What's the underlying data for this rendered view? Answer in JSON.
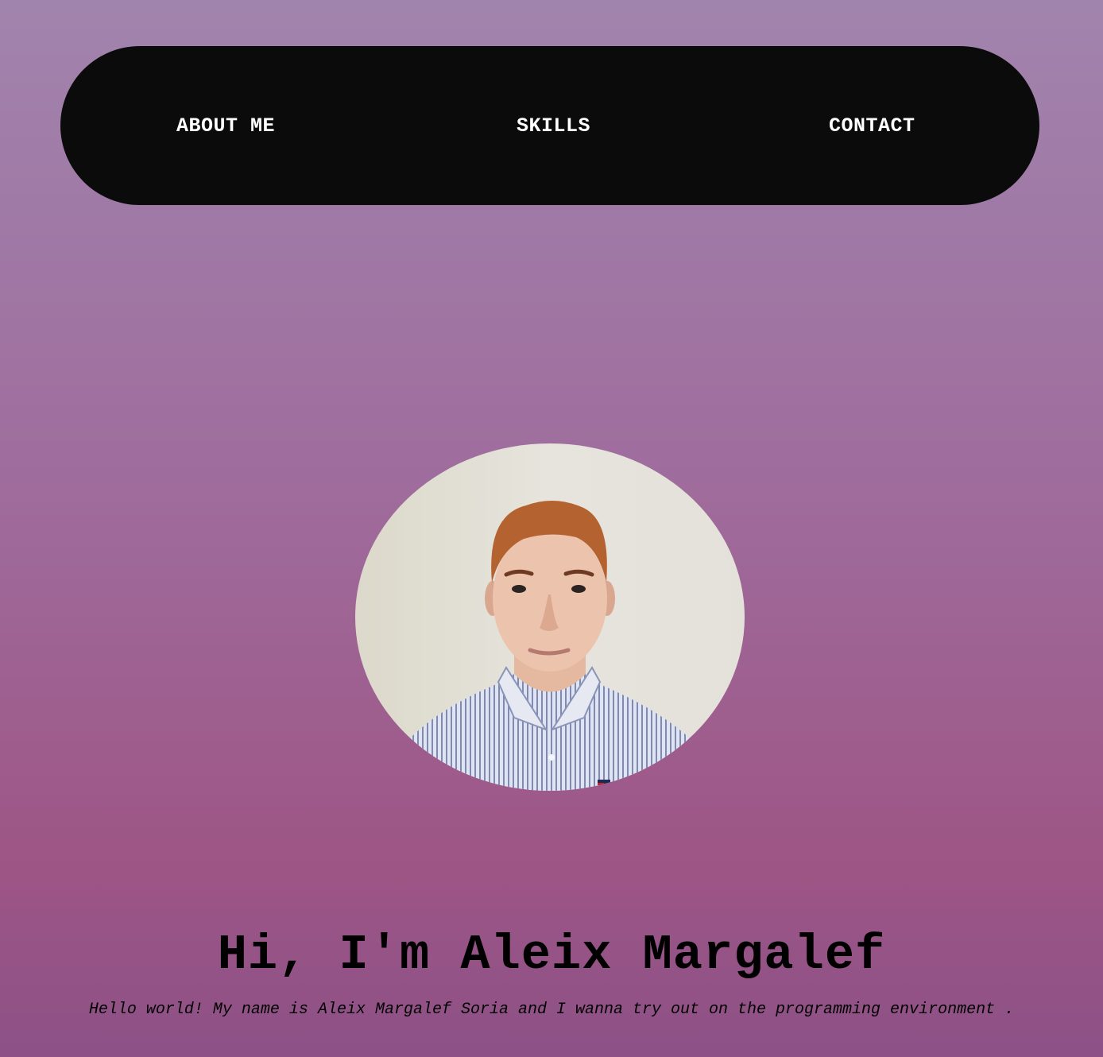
{
  "nav": {
    "items": [
      {
        "label": "ABOUT ME"
      },
      {
        "label": "SKILLS"
      },
      {
        "label": "CONTACT"
      }
    ]
  },
  "profile": {
    "photo_alt": "Portrait photo of Aleix Margalef",
    "title": "Hi, I'm Aleix Margalef",
    "subtitle": "Hello world! My name is Aleix Margalef Soria and I wanna try out on the programming environment ."
  },
  "colors": {
    "navbar_bg": "#0b0b0b",
    "nav_text": "#ffffff",
    "page_gradient_top": "#a184ad",
    "page_gradient_bottom": "#8d5187",
    "heading_text": "#000000"
  }
}
